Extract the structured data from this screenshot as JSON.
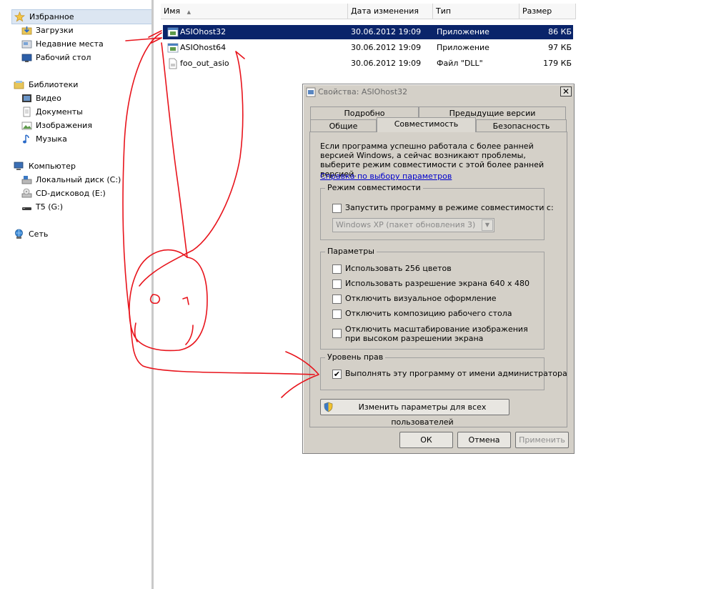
{
  "nav": {
    "favorites": [
      {
        "label": "Избранное",
        "icon": "star-icon"
      },
      {
        "label": "Загрузки",
        "icon": "downloads-folder-icon"
      },
      {
        "label": "Недавние места",
        "icon": "recent-places-icon"
      },
      {
        "label": "Рабочий стол",
        "icon": "desktop-icon"
      }
    ],
    "libraries": [
      {
        "label": "Библиотеки",
        "icon": "libraries-icon"
      },
      {
        "label": "Видео",
        "icon": "video-library-icon"
      },
      {
        "label": "Документы",
        "icon": "documents-library-icon"
      },
      {
        "label": "Изображения",
        "icon": "pictures-library-icon"
      },
      {
        "label": "Музыка",
        "icon": "music-library-icon"
      }
    ],
    "computer": [
      {
        "label": "Компьютер",
        "icon": "computer-icon"
      },
      {
        "label": "Локальный диск (C:)",
        "icon": "local-disk-icon"
      },
      {
        "label": "CD-дисковод (E:)",
        "icon": "cd-drive-icon"
      },
      {
        "label": "T5 (G:)",
        "icon": "usb-drive-icon"
      }
    ],
    "network": {
      "label": "Сеть",
      "icon": "network-icon"
    }
  },
  "columns": {
    "name": "Имя",
    "date": "Дата изменения",
    "type": "Тип",
    "size": "Размер"
  },
  "files": [
    {
      "name": "ASIOhost32",
      "date": "30.06.2012 19:09",
      "type": "Приложение",
      "size": "86 КБ",
      "icon": "application-icon"
    },
    {
      "name": "ASIOhost64",
      "date": "30.06.2012 19:09",
      "type": "Приложение",
      "size": "97 КБ",
      "icon": "application-icon"
    },
    {
      "name": "foo_out_asio",
      "date": "30.06.2012 19:09",
      "type": "Файл \"DLL\"",
      "size": "179 КБ",
      "icon": "dll-file-icon"
    }
  ],
  "dialog": {
    "title": "Свойства: ASIOhost32",
    "close": "✕",
    "tabs_row1": [
      "Подробно",
      "Предыдущие версии"
    ],
    "tabs_row2": [
      "Общие",
      "Совместимость",
      "Безопасность"
    ],
    "intro": "Если программа успешно работала с более ранней версией Windows, а сейчас возникают проблемы, выберите режим совместимости с этой более ранней версией.",
    "help_link": "Справка по выбору параметров",
    "compat_group": {
      "title": "Режим совместимости",
      "checkbox": "Запустить программу в режиме совместимости с:",
      "checked": false,
      "select_value": "Windows XP (пакет обновления 3)"
    },
    "params_group": {
      "title": "Параметры",
      "options": [
        {
          "label": "Использовать 256 цветов",
          "checked": false
        },
        {
          "label": "Использовать разрешение экрана 640 x 480",
          "checked": false
        },
        {
          "label": "Отключить визуальное оформление",
          "checked": false
        },
        {
          "label": "Отключить композицию рабочего стола",
          "checked": false
        },
        {
          "label": "Отключить масштабирование изображения при высоком разрешении экрана",
          "checked": false
        }
      ]
    },
    "priv_group": {
      "title": "Уровень прав",
      "checkbox": "Выполнять эту программу от имени администратора",
      "checked": true
    },
    "all_users_button": "Изменить параметры для всех пользователей",
    "ok": "ОК",
    "cancel": "Отмена",
    "apply": "Применить"
  },
  "colors": {
    "selection": "#0a246a",
    "dialog_bg": "#d4d0c8",
    "annotation": "#e8141c"
  }
}
